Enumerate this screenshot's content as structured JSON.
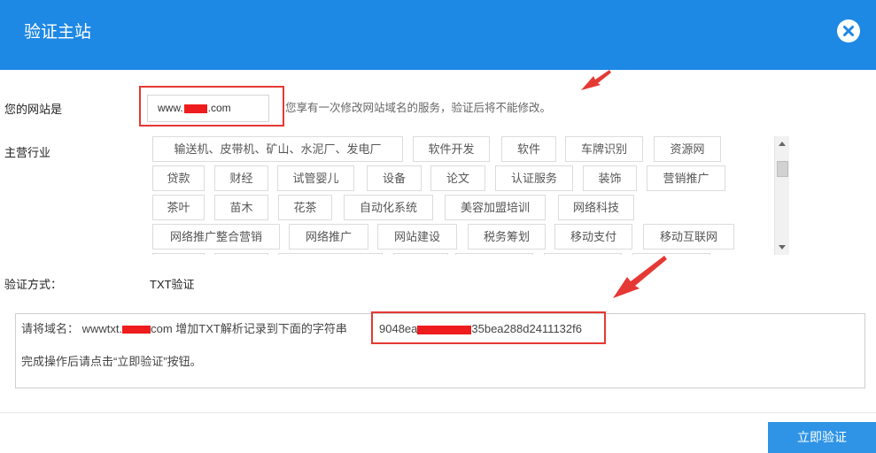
{
  "header": {
    "title": "验证主站",
    "close_icon": "close-icon"
  },
  "website": {
    "label": "您的网站是",
    "value_prefix": "www.",
    "value_suffix": ".com",
    "hint": "您享有一次修改网站域名的服务，验证后将不能修改。"
  },
  "industry": {
    "label": "主营行业",
    "tags": [
      "输送机、皮带机、矿山、水泥厂、发电厂",
      "软件开发",
      "软件",
      "车牌识别",
      "资源网",
      "贷款",
      "财经",
      "试管婴儿",
      "设备",
      "论文",
      "认证服务",
      "装饰",
      "营销推广",
      "茶叶",
      "苗木",
      "花茶",
      "自动化系统",
      "美容加盟培训",
      "网络科技",
      "网络推广整合营销",
      "网络推广",
      "网站建设",
      "税务筹划",
      "移动支付",
      "移动互联网"
    ]
  },
  "verification": {
    "label": "验证方式：",
    "method": "TXT验证",
    "line1_prefix": "请将域名： wwwtxt.",
    "line1_mid": "com 增加TXT解析记录到下面的字符串",
    "record_prefix": "9048ea",
    "record_suffix": "35bea288d2411132f6",
    "line2": "完成操作后请点击“立即验证”按钮。"
  },
  "footer": {
    "verify_button": "立即验证"
  },
  "colors": {
    "header_bg": "#1e88e5",
    "button_bg": "#2f94e6",
    "highlight_red": "#e53935"
  }
}
